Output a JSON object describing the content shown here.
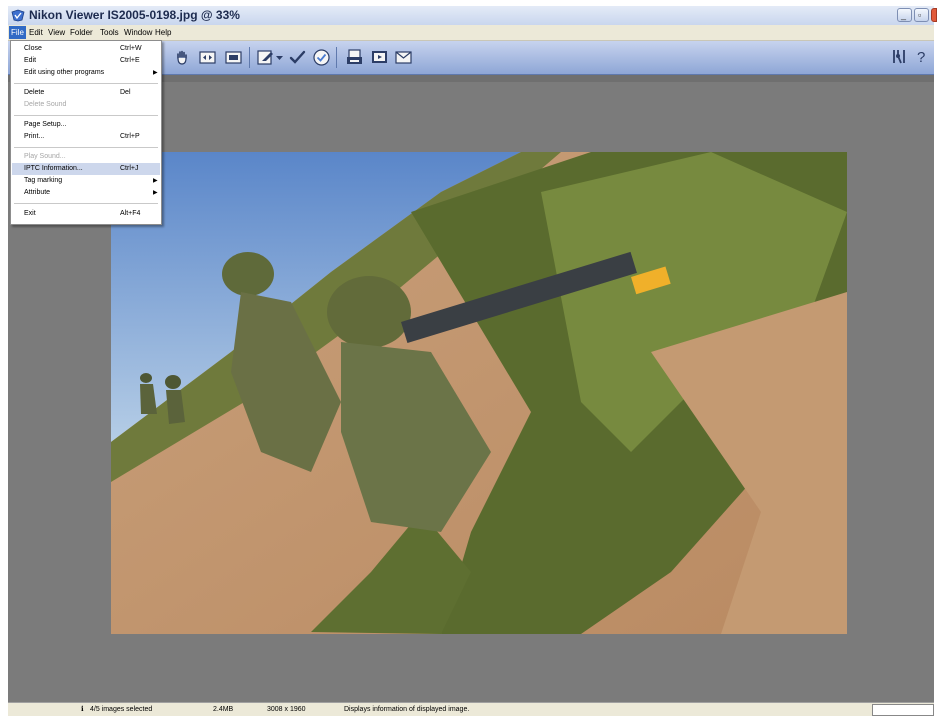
{
  "window": {
    "title": "Nikon Viewer IS2005-0198.jpg @ 33%"
  },
  "menubar": {
    "items": [
      "File",
      "Edit",
      "View",
      "Folder",
      "Tools",
      "Window",
      "Help"
    ],
    "active": "File"
  },
  "file_menu": {
    "items": [
      {
        "label": "Close",
        "shortcut": "Ctrl+W",
        "enabled": true
      },
      {
        "label": "Edit",
        "shortcut": "Ctrl+E",
        "enabled": true
      },
      {
        "label": "Edit using other programs",
        "submenu": true,
        "enabled": true
      },
      {
        "label": "Delete",
        "shortcut": "Del",
        "enabled": true
      },
      {
        "label": "Delete Sound",
        "enabled": false
      },
      {
        "label": "Page Setup...",
        "enabled": true
      },
      {
        "label": "Print...",
        "shortcut": "Ctrl+P",
        "enabled": true
      },
      {
        "label": "Play Sound...",
        "enabled": false
      },
      {
        "label": "IPTC Information...",
        "shortcut": "Ctrl+J",
        "enabled": true,
        "highlighted": true
      },
      {
        "label": "Tag marking",
        "submenu": true,
        "enabled": true
      },
      {
        "label": "Attribute",
        "submenu": true,
        "enabled": true
      },
      {
        "label": "Exit",
        "shortcut": "Alt+F4",
        "enabled": true
      }
    ]
  },
  "toolbar": {
    "icons": [
      "hand-icon",
      "fit-window-icon",
      "full-screen-icon",
      "edit-icon",
      "dropdown-arrow-icon",
      "check-icon",
      "protect-icon",
      "print-icon",
      "slideshow-icon",
      "email-icon"
    ],
    "right_icons": [
      "tools-icon",
      "help-icon"
    ]
  },
  "status": {
    "selection": "4/5 images selected",
    "size": "2.4MB",
    "dimensions": "3008 x 1960",
    "message": "Displays information of displayed image."
  },
  "colors": {
    "accent": "#316ac5",
    "toolbar": "#a9bbe2",
    "viewer_bg": "#7b7b7b"
  }
}
